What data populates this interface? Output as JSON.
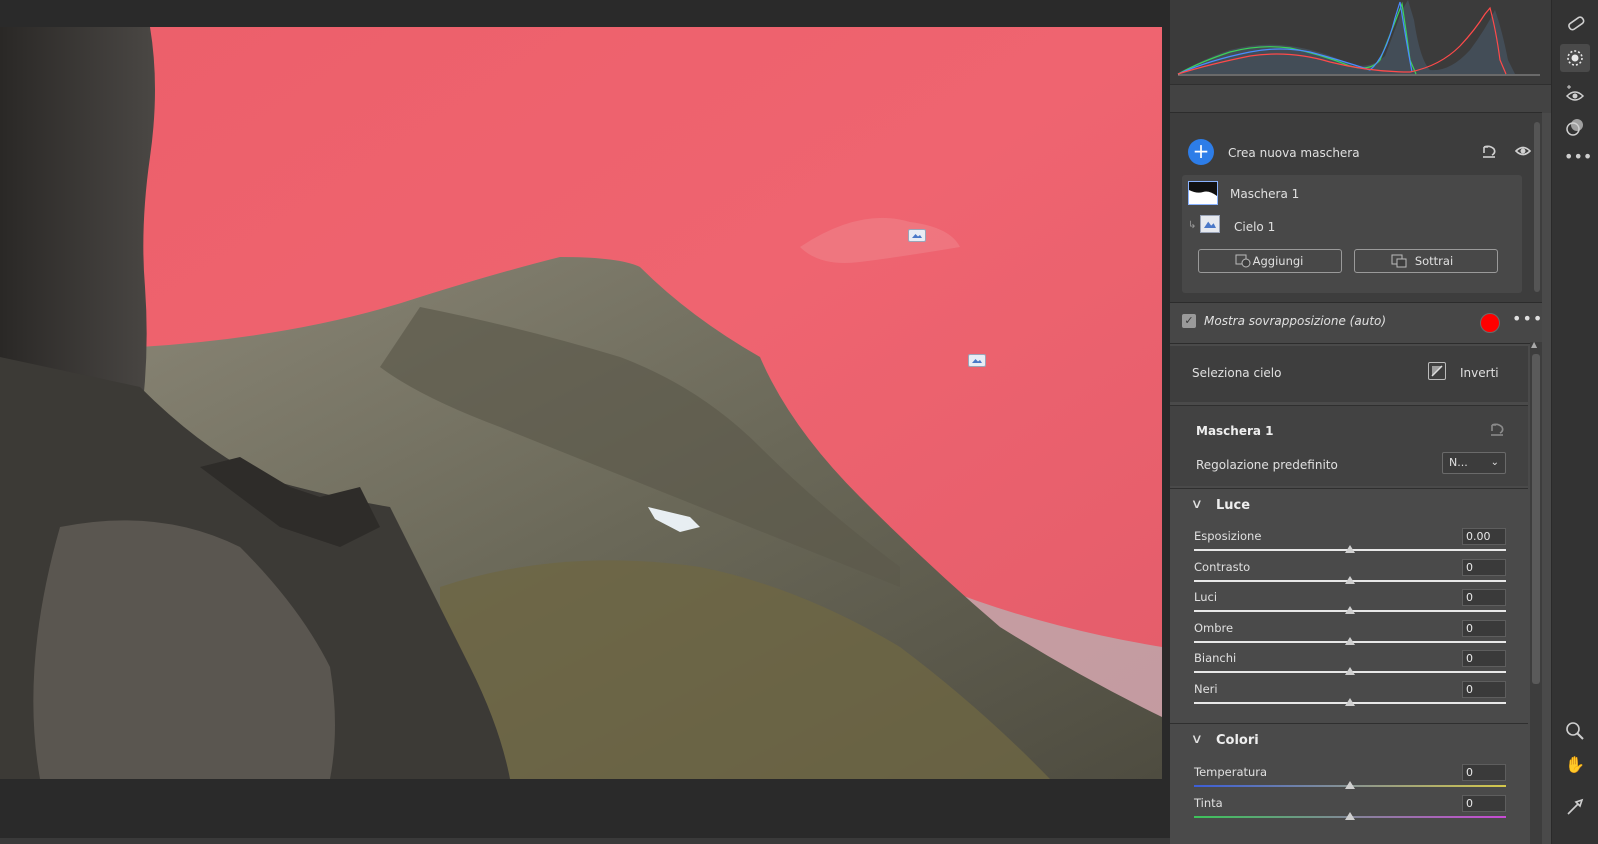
{
  "masks_panel": {
    "create_label": "Crea nuova maschera",
    "mask1_label": "Maschera 1",
    "sky_label": "Cielo 1",
    "add_label": "Aggiungi",
    "subtract_label": "Sottrai"
  },
  "overlay": {
    "label": "Mostra sovrapposizione (auto)",
    "checked": true,
    "color": "#ff0000"
  },
  "sky_selection": {
    "label": "Seleziona cielo",
    "invert_label": "Inverti"
  },
  "mask_settings": {
    "name": "Maschera 1",
    "preset_label": "Regolazione predefinito",
    "preset_value": "N..."
  },
  "sections": {
    "luce": "Luce",
    "colori": "Colori"
  },
  "sliders": {
    "luce": [
      {
        "label": "Esposizione",
        "value": "0.00",
        "level": 0.5
      },
      {
        "label": "Contrasto",
        "value": "0",
        "level": 0.5
      },
      {
        "label": "Luci",
        "value": "0",
        "level": 0.5
      },
      {
        "label": "Ombre",
        "value": "0",
        "level": 0.5
      },
      {
        "label": "Bianchi",
        "value": "0",
        "level": 0.5
      },
      {
        "label": "Neri",
        "value": "0",
        "level": 0.5
      }
    ],
    "colori": [
      {
        "label": "Temperatura",
        "value": "0",
        "level": 0.5
      },
      {
        "label": "Tinta",
        "value": "0",
        "level": 0.5
      }
    ]
  },
  "colors": {
    "accent": "#2d7de8",
    "mask_overlay": "#ff0000",
    "panel_bg": "#4a4a4a"
  },
  "toolbar_icons": [
    "healing-icon",
    "masking-icon",
    "red-eye-icon",
    "presets-icon",
    "more-icon",
    "zoom-icon",
    "hand-icon",
    "sampler-icon"
  ]
}
